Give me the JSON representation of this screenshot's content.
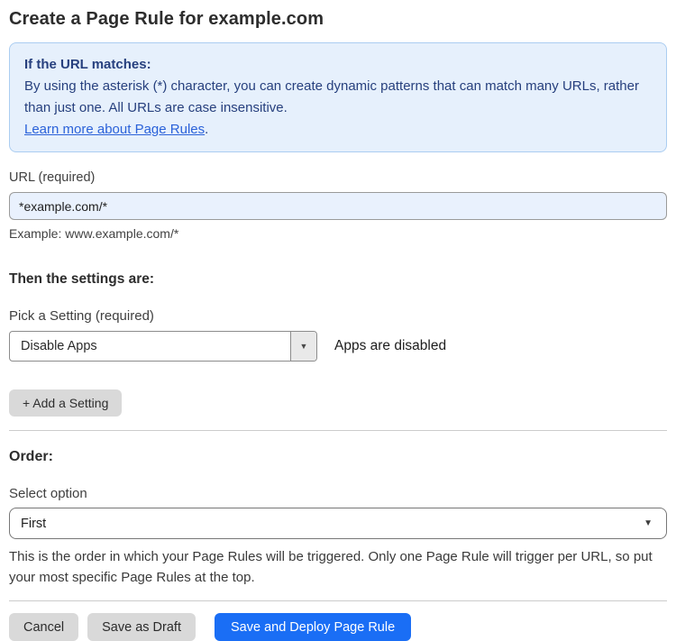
{
  "page": {
    "title": "Create a Page Rule for example.com"
  },
  "info_box": {
    "heading": "If the URL matches:",
    "body": "By using the asterisk (*) character, you can create dynamic patterns that can match many URLs, rather than just one. All URLs are case insensitive.",
    "link_label": "Learn more about Page Rules",
    "link_suffix": "."
  },
  "url_field": {
    "label": "URL (required)",
    "value": "*example.com/*",
    "helper": "Example: www.example.com/*"
  },
  "settings": {
    "heading": "Then the settings are:",
    "pick_label": "Pick a Setting (required)",
    "selected_setting": "Disable Apps",
    "dropdown_caret": "▼",
    "status_text": "Apps are disabled",
    "add_setting_label": "+ Add a Setting"
  },
  "order": {
    "heading": "Order:",
    "select_label": "Select option",
    "selected_option": "First",
    "dropdown_caret": "▼",
    "helper": "This is the order in which your Page Rules will be triggered. Only one Page Rule will trigger per URL, so put your most specific Page Rules at the top."
  },
  "actions": {
    "cancel_label": "Cancel",
    "save_draft_label": "Save as Draft",
    "save_deploy_label": "Save and Deploy Page Rule"
  },
  "colors": {
    "primary_button_blue": "#1a6ef5",
    "info_box_background": "#e6f0fc",
    "info_box_border": "#abcdf1",
    "info_box_text": "#27407e",
    "link_blue": "#2b62d9",
    "url_input_background": "#e9f1fd",
    "gray_button_background": "#d9d9d9"
  }
}
